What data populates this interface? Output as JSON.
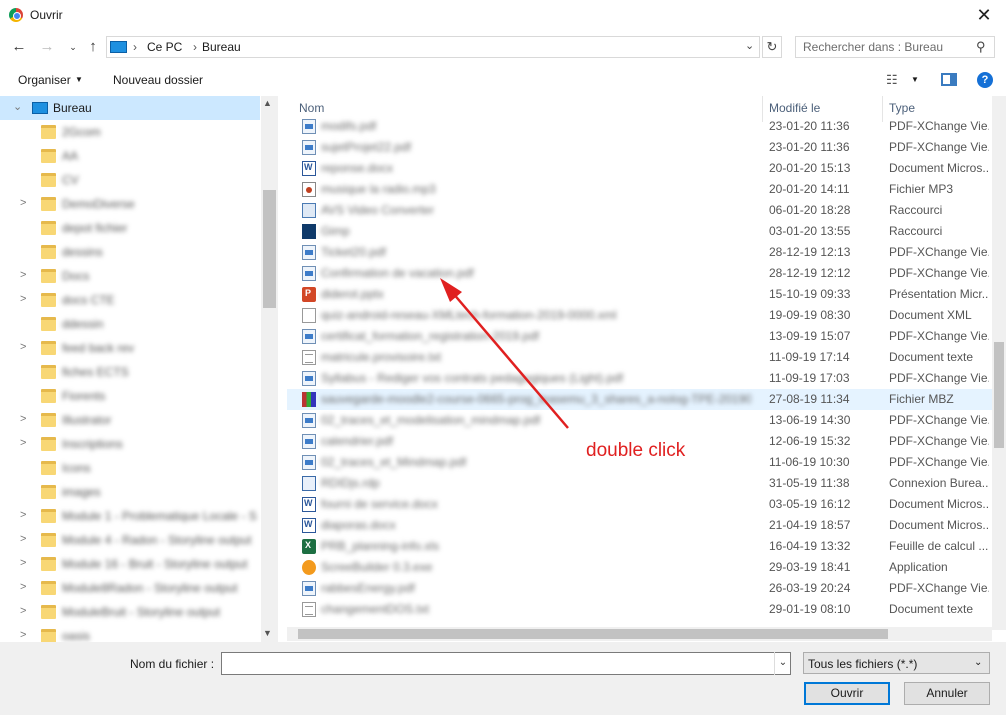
{
  "window": {
    "title": "Ouvrir",
    "close_icon": "close-icon"
  },
  "address": {
    "root": "Ce PC",
    "current": "Bureau"
  },
  "search": {
    "placeholder": "Rechercher dans : Bureau"
  },
  "toolbar": {
    "organiser": "Organiser",
    "new_folder": "Nouveau dossier"
  },
  "tree": {
    "selected": "Bureau",
    "items": [
      {
        "label": "2Gcom",
        "expand": ""
      },
      {
        "label": "AA",
        "expand": ""
      },
      {
        "label": "CV",
        "expand": ""
      },
      {
        "label": "DemoDiverse",
        "expand": ">"
      },
      {
        "label": "depot fichier",
        "expand": ""
      },
      {
        "label": "dessins",
        "expand": ""
      },
      {
        "label": "Docs",
        "expand": ">"
      },
      {
        "label": "docs CTE",
        "expand": ">"
      },
      {
        "label": "ddessin",
        "expand": ""
      },
      {
        "label": "feed back rev",
        "expand": ">"
      },
      {
        "label": "fiches ECTS",
        "expand": ""
      },
      {
        "label": "Fiorents",
        "expand": ""
      },
      {
        "label": "Illustrator",
        "expand": ">"
      },
      {
        "label": "Inscriptions",
        "expand": ">"
      },
      {
        "label": "Icons",
        "expand": ""
      },
      {
        "label": "images",
        "expand": ""
      },
      {
        "label": "Module 1 - Problematique Locale - S",
        "expand": ">"
      },
      {
        "label": "Module 4 - Radon - Storyline output",
        "expand": ">"
      },
      {
        "label": "Module 16 - Bruit - Storyline output",
        "expand": ">"
      },
      {
        "label": "Module8Radon - Storyline output",
        "expand": ">"
      },
      {
        "label": "ModuleBruit - Storyline output",
        "expand": ">"
      },
      {
        "label": "oasis",
        "expand": ">"
      }
    ]
  },
  "columns": {
    "name": "Nom",
    "modified": "Modifié le",
    "type": "Type"
  },
  "files": [
    {
      "name": "modifs.pdf",
      "date": "23-01-20 11:36",
      "type": "PDF-XChange Vie...",
      "icon": "pdf"
    },
    {
      "name": "sujetProjet22.pdf",
      "date": "23-01-20 11:36",
      "type": "PDF-XChange Vie...",
      "icon": "pdf"
    },
    {
      "name": "reponse.docx",
      "date": "20-01-20 15:13",
      "type": "Document Micros...",
      "icon": "doc"
    },
    {
      "name": "musique la radio.mp3",
      "date": "20-01-20 14:11",
      "type": "Fichier MP3",
      "icon": "mp3"
    },
    {
      "name": "AVS Video Converter",
      "date": "06-01-20 18:28",
      "type": "Raccourci",
      "icon": "lnk"
    },
    {
      "name": "Gimp",
      "date": "03-01-20 13:55",
      "type": "Raccourci",
      "icon": "lnk2"
    },
    {
      "name": "Ticket20.pdf",
      "date": "28-12-19 12:13",
      "type": "PDF-XChange Vie...",
      "icon": "pdf"
    },
    {
      "name": "Confirmation de vacation.pdf",
      "date": "28-12-19 12:12",
      "type": "PDF-XChange Vie...",
      "icon": "pdf"
    },
    {
      "name": "diderot.pptx",
      "date": "15-10-19 09:33",
      "type": "Présentation Micr...",
      "icon": "ppt"
    },
    {
      "name": "quiz-android-reseau-XMLtech-formation-2019-0000.xml",
      "date": "19-09-19 08:30",
      "type": "Document XML",
      "icon": "xml"
    },
    {
      "name": "certificat_formation_registration-2019.pdf",
      "date": "13-09-19 15:07",
      "type": "PDF-XChange Vie...",
      "icon": "pdf"
    },
    {
      "name": "matricule.provisoire.txt",
      "date": "11-09-19 17:14",
      "type": "Document texte",
      "icon": "txt"
    },
    {
      "name": "Syllabus - Rediger vos contrats pedagogiques (Light).pdf",
      "date": "11-09-19 17:03",
      "type": "PDF-XChange Vie...",
      "icon": "pdf"
    },
    {
      "name": "sauvegarde-moodle2-course-0665-prog_leasemu_3_shares_a-nolog-TPE-20190827...",
      "date": "27-08-19 11:34",
      "type": "Fichier MBZ",
      "icon": "mbz",
      "highlight": true
    },
    {
      "name": "02_traces_et_modelisation_mindmap.pdf",
      "date": "13-06-19 14:30",
      "type": "PDF-XChange Vie...",
      "icon": "pdf"
    },
    {
      "name": "calendrier.pdf",
      "date": "12-06-19 15:32",
      "type": "PDF-XChange Vie...",
      "icon": "pdf"
    },
    {
      "name": "02_traces_et_Mindmap.pdf",
      "date": "11-06-19 10:30",
      "type": "PDF-XChange Vie...",
      "icon": "pdf"
    },
    {
      "name": "RDIDjs.rdp",
      "date": "31-05-19 11:38",
      "type": "Connexion Burea...",
      "icon": "rdp"
    },
    {
      "name": "fourni de service.docx",
      "date": "03-05-19 16:12",
      "type": "Document Micros...",
      "icon": "doc"
    },
    {
      "name": "diaporas.docx",
      "date": "21-04-19 18:57",
      "type": "Document Micros...",
      "icon": "doc"
    },
    {
      "name": "PRB_planning-info.xls",
      "date": "16-04-19 13:32",
      "type": "Feuille de calcul ...",
      "icon": "xls"
    },
    {
      "name": "ScreeBuilder 0.3.exe",
      "date": "29-03-19 18:41",
      "type": "Application",
      "icon": "app"
    },
    {
      "name": "rabbesEnergy.pdf",
      "date": "26-03-19 20:24",
      "type": "PDF-XChange Vie...",
      "icon": "pdf"
    },
    {
      "name": "changementDOS.txt",
      "date": "29-01-19 08:10",
      "type": "Document texte",
      "icon": "txt"
    }
  ],
  "bottom": {
    "filename_label": "Nom du fichier :",
    "filename_value": "",
    "filter": "Tous les fichiers (*.*)",
    "open": "Ouvrir",
    "cancel": "Annuler"
  },
  "annotation": {
    "text": "double click",
    "color": "#e02020"
  }
}
